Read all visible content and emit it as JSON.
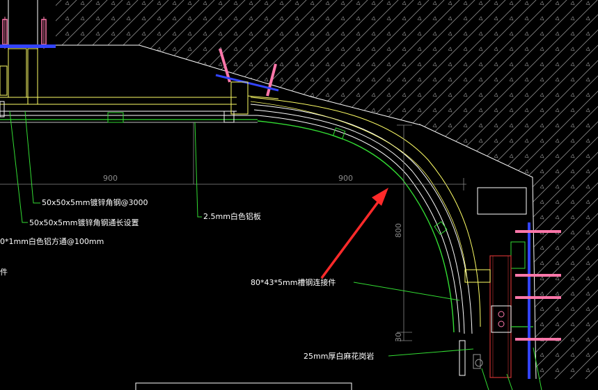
{
  "dimensions": {
    "left_900": "900",
    "right_900": "900",
    "height_800": "800",
    "bottom_30": "30"
  },
  "labels": {
    "angle_steel": "50x50x5mm镀锌角钢@3000",
    "angle_steel_long": "50x50x5mm镀锌角钢通长设置",
    "alu_square_tube": "0*1mm白色铝方通@100mm",
    "aluminum_plate": "2.5mm白色铝板",
    "steel_connector": "80*43*5mm槽钢连接件",
    "granite": "25mm厚白麻花岗岩",
    "left_edge_char": "件"
  },
  "colors": {
    "background": "#000000",
    "yellow_outline": "#ffff66",
    "leader_green": "#33dd33",
    "white_line": "#ffffff",
    "dim_gray": "#8a8a8a",
    "arrow_red": "#ff2a2a",
    "bolt_blue": "#3344ff",
    "bolt_pink": "#ff77aa",
    "steel_red": "#cc3333"
  }
}
